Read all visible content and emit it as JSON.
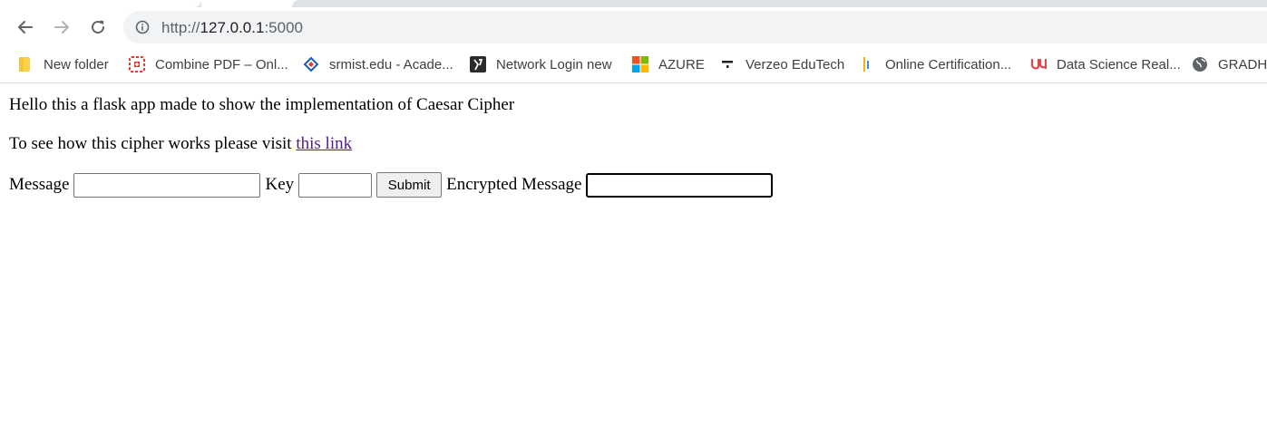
{
  "browser": {
    "url_scheme": "http://",
    "url_host": "127.0.0.1",
    "url_port": ":5000",
    "bookmarks": [
      {
        "label": "New folder",
        "icon": "folder-icon"
      },
      {
        "label": "Combine PDF – Onl...",
        "icon": "combine-pdf-icon"
      },
      {
        "label": "srmist.edu - Acade...",
        "icon": "srmist-icon"
      },
      {
        "label": "Network Login new",
        "icon": "network-login-icon"
      },
      {
        "label": "AZURE",
        "icon": "microsoft-icon"
      },
      {
        "label": "Verzeo EduTech",
        "icon": "verzeo-icon"
      },
      {
        "label": "Online Certification...",
        "icon": "certification-icon"
      },
      {
        "label": "Data Science Real...",
        "icon": "udemy-icon"
      },
      {
        "label": "GRADHa",
        "icon": "globe-icon"
      }
    ]
  },
  "page": {
    "intro": "Hello this a flask app made to show the implementation of Caesar Cipher",
    "visit_text": "To see how this cipher works please visit ",
    "link_text": "this link",
    "form": {
      "message_label": "Message",
      "message_value": "",
      "key_label": "Key",
      "key_value": "",
      "submit_label": "Submit",
      "encrypted_label": "Encrypted Message",
      "encrypted_value": ""
    }
  }
}
